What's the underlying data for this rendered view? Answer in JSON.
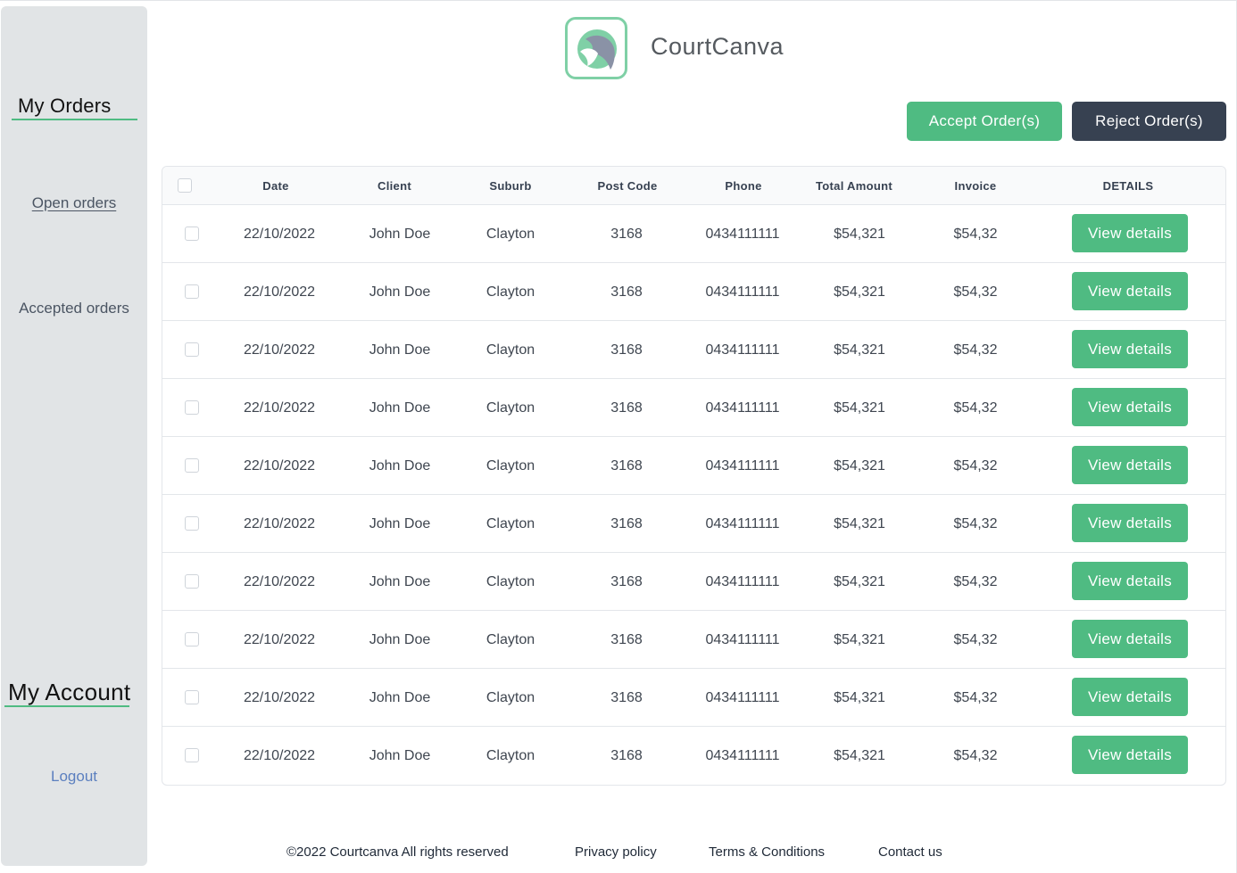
{
  "sidebar": {
    "orders_title": "My Orders",
    "open_orders": "Open orders",
    "accepted_orders": "Accepted orders",
    "account_title": "My Account",
    "logout": "Logout"
  },
  "header": {
    "brand": "CourtCanva",
    "logo_icon": "courtcanva-logo-icon"
  },
  "actions": {
    "accept_label": "Accept Order(s)",
    "reject_label": "Reject  Order(s)"
  },
  "table": {
    "headers": [
      "Date",
      "Client",
      "Suburb",
      "Post Code",
      "Phone",
      "Total Amount",
      "Invoice",
      "DETAILS"
    ],
    "rows": [
      {
        "date": "22/10/2022",
        "client": "John Doe",
        "suburb": "Clayton",
        "postcode": "3168",
        "phone": "0434111111",
        "total": "$54,321",
        "invoice": "$54,32",
        "details": "View details"
      },
      {
        "date": "22/10/2022",
        "client": "John Doe",
        "suburb": "Clayton",
        "postcode": "3168",
        "phone": "0434111111",
        "total": "$54,321",
        "invoice": "$54,32",
        "details": "View details"
      },
      {
        "date": "22/10/2022",
        "client": "John Doe",
        "suburb": "Clayton",
        "postcode": "3168",
        "phone": "0434111111",
        "total": "$54,321",
        "invoice": "$54,32",
        "details": "View details"
      },
      {
        "date": "22/10/2022",
        "client": "John Doe",
        "suburb": "Clayton",
        "postcode": "3168",
        "phone": "0434111111",
        "total": "$54,321",
        "invoice": "$54,32",
        "details": "View details"
      },
      {
        "date": "22/10/2022",
        "client": "John Doe",
        "suburb": "Clayton",
        "postcode": "3168",
        "phone": "0434111111",
        "total": "$54,321",
        "invoice": "$54,32",
        "details": "View details"
      },
      {
        "date": "22/10/2022",
        "client": "John Doe",
        "suburb": "Clayton",
        "postcode": "3168",
        "phone": "0434111111",
        "total": "$54,321",
        "invoice": "$54,32",
        "details": "View details"
      },
      {
        "date": "22/10/2022",
        "client": "John Doe",
        "suburb": "Clayton",
        "postcode": "3168",
        "phone": "0434111111",
        "total": "$54,321",
        "invoice": "$54,32",
        "details": "View details"
      },
      {
        "date": "22/10/2022",
        "client": "John Doe",
        "suburb": "Clayton",
        "postcode": "3168",
        "phone": "0434111111",
        "total": "$54,321",
        "invoice": "$54,32",
        "details": "View details"
      },
      {
        "date": "22/10/2022",
        "client": "John Doe",
        "suburb": "Clayton",
        "postcode": "3168",
        "phone": "0434111111",
        "total": "$54,321",
        "invoice": "$54,32",
        "details": "View details"
      },
      {
        "date": "22/10/2022",
        "client": "John Doe",
        "suburb": "Clayton",
        "postcode": "3168",
        "phone": "0434111111",
        "total": "$54,321",
        "invoice": "$54,32",
        "details": "View details"
      }
    ]
  },
  "footer": {
    "copyright": "©2022 Courtcanva All rights reserved",
    "privacy": "Privacy policy",
    "terms": "Terms & Conditions",
    "contact": "Contact us"
  },
  "colors": {
    "accent": "#4fbb82",
    "dark_button": "#374151",
    "sidebar_bg": "#e1e4e6",
    "logout_link": "#5b7fbf"
  }
}
